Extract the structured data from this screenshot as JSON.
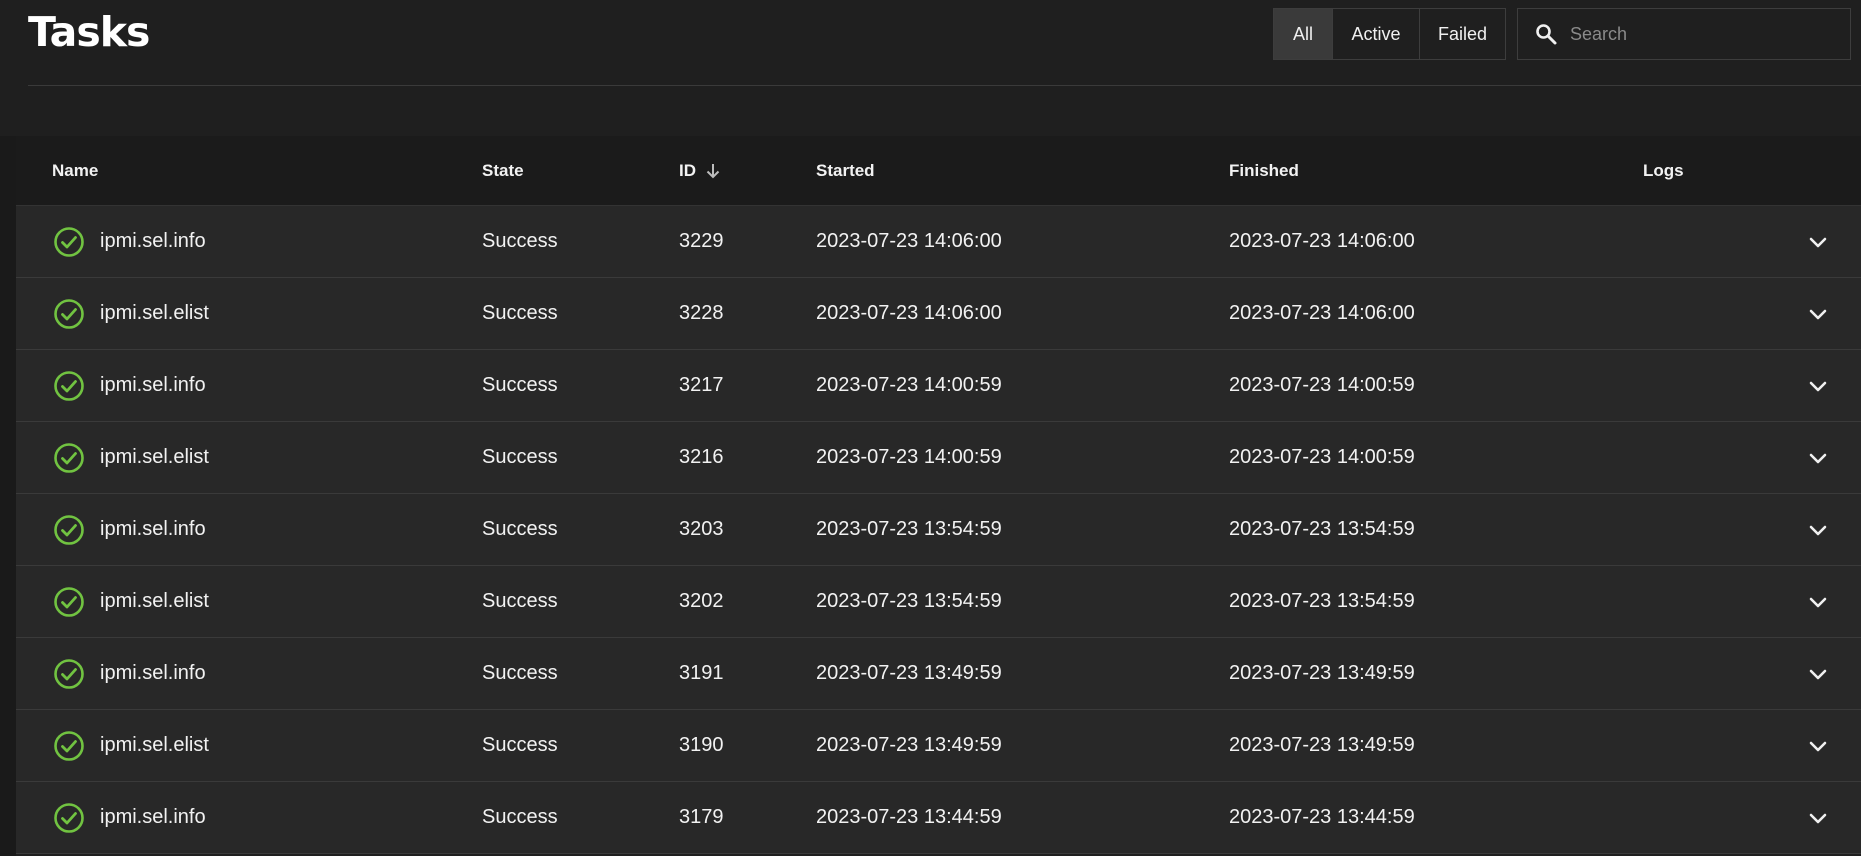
{
  "header": {
    "title": "Tasks",
    "filters": [
      {
        "label": "All",
        "active": true
      },
      {
        "label": "Active",
        "active": false
      },
      {
        "label": "Failed",
        "active": false
      }
    ],
    "search": {
      "placeholder": "Search",
      "value": "",
      "icon": "search-icon"
    }
  },
  "table": {
    "columns": {
      "name": "Name",
      "state": "State",
      "id": "ID",
      "started": "Started",
      "finished": "Finished",
      "logs": "Logs"
    },
    "sort": {
      "column": "ID",
      "direction": "descending",
      "icon": "arrow-down-icon"
    },
    "rows": [
      {
        "status_icon": "check-circle-icon",
        "name": "ipmi.sel.info",
        "state": "Success",
        "id": "3229",
        "started": "2023-07-23 14:06:00",
        "finished": "2023-07-23 14:06:00"
      },
      {
        "status_icon": "check-circle-icon",
        "name": "ipmi.sel.elist",
        "state": "Success",
        "id": "3228",
        "started": "2023-07-23 14:06:00",
        "finished": "2023-07-23 14:06:00"
      },
      {
        "status_icon": "check-circle-icon",
        "name": "ipmi.sel.info",
        "state": "Success",
        "id": "3217",
        "started": "2023-07-23 14:00:59",
        "finished": "2023-07-23 14:00:59"
      },
      {
        "status_icon": "check-circle-icon",
        "name": "ipmi.sel.elist",
        "state": "Success",
        "id": "3216",
        "started": "2023-07-23 14:00:59",
        "finished": "2023-07-23 14:00:59"
      },
      {
        "status_icon": "check-circle-icon",
        "name": "ipmi.sel.info",
        "state": "Success",
        "id": "3203",
        "started": "2023-07-23 13:54:59",
        "finished": "2023-07-23 13:54:59"
      },
      {
        "status_icon": "check-circle-icon",
        "name": "ipmi.sel.elist",
        "state": "Success",
        "id": "3202",
        "started": "2023-07-23 13:54:59",
        "finished": "2023-07-23 13:54:59"
      },
      {
        "status_icon": "check-circle-icon",
        "name": "ipmi.sel.info",
        "state": "Success",
        "id": "3191",
        "started": "2023-07-23 13:49:59",
        "finished": "2023-07-23 13:49:59"
      },
      {
        "status_icon": "check-circle-icon",
        "name": "ipmi.sel.elist",
        "state": "Success",
        "id": "3190",
        "started": "2023-07-23 13:49:59",
        "finished": "2023-07-23 13:49:59"
      },
      {
        "status_icon": "check-circle-icon",
        "name": "ipmi.sel.info",
        "state": "Success",
        "id": "3179",
        "started": "2023-07-23 13:44:59",
        "finished": "2023-07-23 13:44:59"
      }
    ]
  },
  "colors": {
    "background": "#1f1f1f",
    "row_background": "#282828",
    "success": "#71c341",
    "active_filter": "#3a3a3a"
  }
}
